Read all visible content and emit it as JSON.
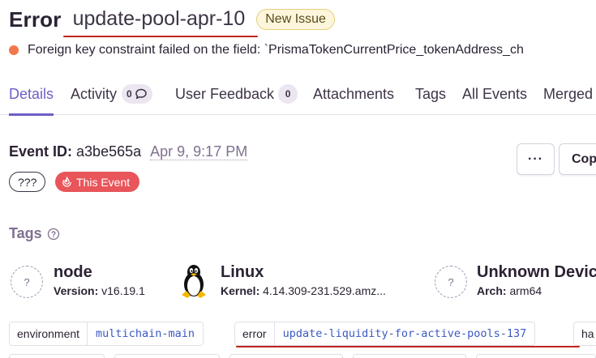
{
  "header": {
    "type": "Error",
    "culprit": "update-pool-apr-10",
    "badge": "New Issue",
    "message": "Foreign key constraint failed on the field: `PrismaTokenCurrentPrice_tokenAddress_ch"
  },
  "tabs": [
    {
      "label": "Details",
      "active": true
    },
    {
      "label": "Activity",
      "count": "0"
    },
    {
      "label": "User Feedback",
      "count": "0"
    },
    {
      "label": "Attachments"
    },
    {
      "label": "Tags"
    },
    {
      "label": "All Events"
    },
    {
      "label": "Merged"
    }
  ],
  "event": {
    "id_label": "Event ID:",
    "id": "a3be565a",
    "date": "Apr 9, 9:17 PM",
    "chip_unknown": "???",
    "this_event": "This Event",
    "more_label": "···",
    "copy_label": "Cop"
  },
  "tags_section": {
    "title": "Tags",
    "contexts": [
      {
        "name": "node",
        "detail_label": "Version:",
        "detail_value": "v16.19.1",
        "icon": "unknown-icon"
      },
      {
        "name": "Linux",
        "detail_label": "Kernel:",
        "detail_value": "4.14.309-231.529.amz...",
        "icon": "linux-tux-icon"
      },
      {
        "name": "Unknown Devic",
        "detail_label": "Arch:",
        "detail_value": "arm64",
        "icon": "unknown-icon"
      }
    ],
    "unknown_glyph": "?",
    "pairs": [
      {
        "key": "environment",
        "value": "multichain-main"
      },
      {
        "key": "error",
        "value": "update-liquidity-for-active-pools-137"
      },
      {
        "key": "ha",
        "value": ""
      }
    ]
  },
  "colors": {
    "accent": "#6c5fc7",
    "error_level": "#f2784b",
    "this_event": "#e8555a",
    "underline": "#c0241e",
    "tag_value": "#3b59c4"
  }
}
